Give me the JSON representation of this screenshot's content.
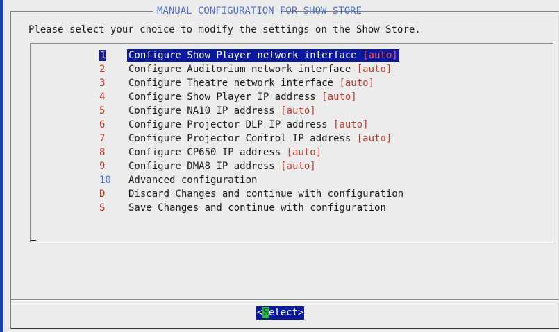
{
  "dialog": {
    "title": "MANUAL CONFIGURATION FOR SHOW STORE",
    "subtitle": "Please select your choice to modify the settings on the Show Store."
  },
  "menu": {
    "items": [
      {
        "tag": "1",
        "text": "Configure Show Player network interface ",
        "suffix": "[auto]",
        "selected": true
      },
      {
        "tag": "2",
        "text": "Configure Auditorium network interface ",
        "suffix": "[auto]"
      },
      {
        "tag": "3",
        "text": "Configure Theatre network interface ",
        "suffix": "[auto]"
      },
      {
        "tag": "4",
        "text": "Configure Show Player IP address ",
        "suffix": "[auto]"
      },
      {
        "tag": "5",
        "text": "Configure NA10 IP address ",
        "suffix": "[auto]"
      },
      {
        "tag": "6",
        "text": "Configure Projector DLP IP address ",
        "suffix": "[auto]"
      },
      {
        "tag": "7",
        "text": "Configure Projector Control IP address ",
        "suffix": "[auto]"
      },
      {
        "tag": "8",
        "text": "Configure CP650 IP address ",
        "suffix": "[auto]"
      },
      {
        "tag": "9",
        "text": "Configure DMA8 IP address ",
        "suffix": "[auto]"
      },
      {
        "tag": "10",
        "text": "Advanced configuration",
        "suffix": ""
      },
      {
        "tag": "D",
        "text": "Discard Changes and continue with configuration",
        "suffix": ""
      },
      {
        "tag": "S",
        "text": "Save Changes and continue with configuration",
        "suffix": ""
      }
    ]
  },
  "button": {
    "open": "<",
    "hotkey": "S",
    "rest": "elect",
    "close": ">"
  },
  "colors": {
    "background": "#1c3fa8",
    "dialog": "#ececec",
    "highlight": "#0a1a9e",
    "tag_red": "#c0392b",
    "title_blue": "#4b6cc8",
    "hotkey_green": "#1ec31e"
  }
}
